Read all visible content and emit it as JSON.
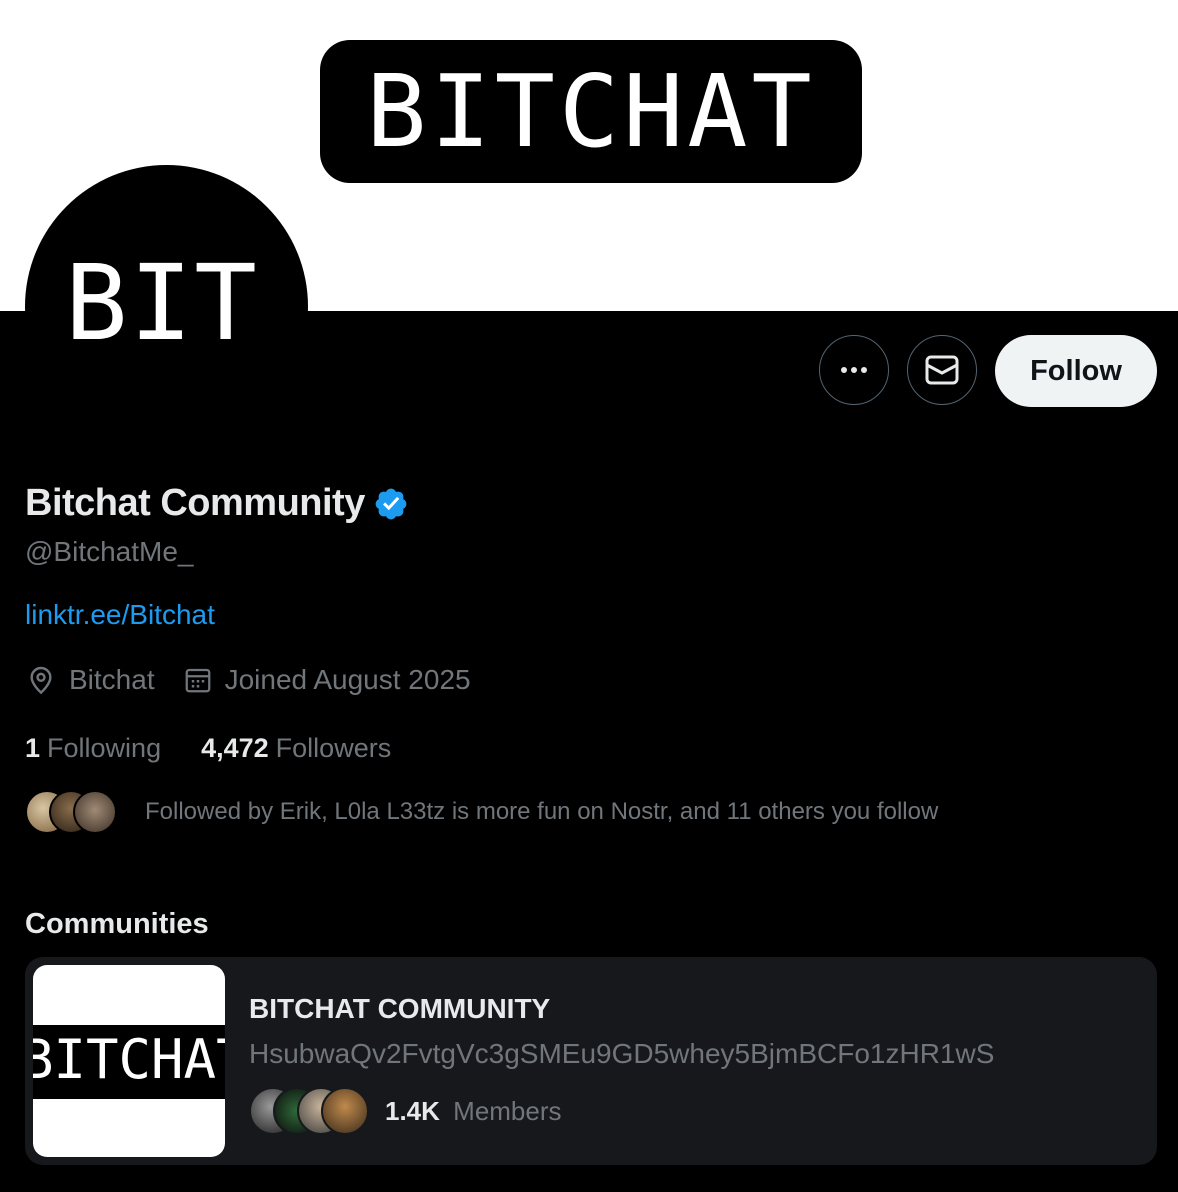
{
  "banner": {
    "logo_text": "BITCHAT"
  },
  "avatar": {
    "text": "BIT"
  },
  "actions": {
    "follow_label": "Follow"
  },
  "profile": {
    "name": "Bitchat Community",
    "handle": "@BitchatMe_",
    "link": "linktr.ee/Bitchat",
    "location": "Bitchat",
    "joined": "Joined August 2025",
    "following_count": "1",
    "following_label": "Following",
    "followers_count": "4,472",
    "followers_label": "Followers",
    "followed_by": "Followed by Erik, L0la L33tz is more fun on Nostr, and 11 others you follow"
  },
  "communities": {
    "title": "Communities",
    "items": [
      {
        "thumb_text": "BITCHAT",
        "name": "BITCHAT COMMUNITY",
        "description": "HsubwaQv2FvtgVc3gSMEu9GD5whey5BjmBCFo1zHR1wS",
        "members_count": "1.4K",
        "members_label": "Members"
      }
    ]
  },
  "colors": {
    "background": "#000000",
    "accent_link": "#1d9bf0",
    "verified": "#1d9bf0",
    "muted_text": "#71767b",
    "card": "#16181c",
    "follow_button": "#eff3f4"
  },
  "icons": [
    "more-icon",
    "mail-icon",
    "verified-badge-icon",
    "location-icon",
    "calendar-icon"
  ]
}
